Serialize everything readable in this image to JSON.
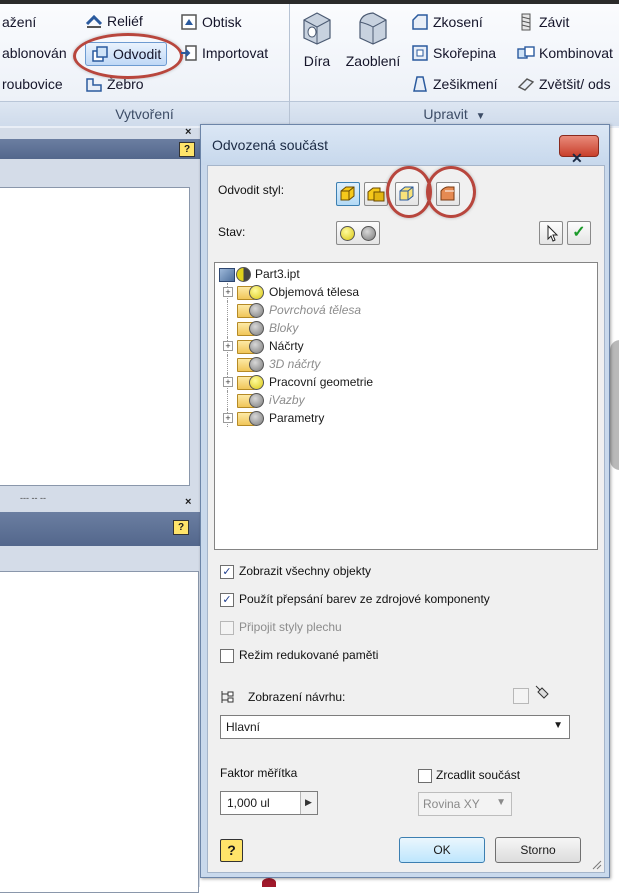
{
  "ribbon": {
    "col1": [
      "ažení",
      "ablonován",
      "roubovice"
    ],
    "col2": [
      "Reliéf",
      "Odvodit",
      "Žebro"
    ],
    "col3": [
      "Obtisk",
      "Importovat"
    ],
    "big_buttons": [
      "Díra",
      "Zaoblení"
    ],
    "col4": [
      "Zkosení",
      "Skořepina",
      "Zešikmení"
    ],
    "col5": [
      "Závit",
      "Kombinovat",
      "Zvětšit/ ods"
    ],
    "panel_create": "Vytvoření",
    "panel_modify": "Upravit",
    "panel_modify_arrow": "▼"
  },
  "left_pane": {
    "close_glyph": "×",
    "help_glyph": "?",
    "fragment": "--- -- --"
  },
  "dialog": {
    "title": "Odvozená součást",
    "close_glyph": "✕",
    "derive_style_label": "Odvodit styl:",
    "state_label": "Stav:",
    "tree": [
      {
        "label": "Part3.ipt",
        "level": 0,
        "icon": "part-icon",
        "expander": false,
        "state": "half",
        "disabled": false
      },
      {
        "label": "Objemová tělesa",
        "level": 1,
        "icon": "folder-icon",
        "expander": true,
        "state": "include",
        "disabled": false
      },
      {
        "label": "Povrchová tělesa",
        "level": 1,
        "icon": "folder-icon",
        "expander": false,
        "state": "exclude",
        "disabled": true
      },
      {
        "label": "Bloky",
        "level": 1,
        "icon": "folder-icon",
        "expander": false,
        "state": "exclude",
        "disabled": true
      },
      {
        "label": "Náčrty",
        "level": 1,
        "icon": "folder-icon",
        "expander": true,
        "state": "exclude",
        "disabled": false
      },
      {
        "label": "3D náčrty",
        "level": 1,
        "icon": "folder-icon",
        "expander": false,
        "state": "exclude",
        "disabled": true
      },
      {
        "label": "Pracovní geometrie",
        "level": 1,
        "icon": "folder-icon",
        "expander": true,
        "state": "include",
        "disabled": false
      },
      {
        "label": "iVazby",
        "level": 1,
        "icon": "folder-icon",
        "expander": false,
        "state": "exclude",
        "disabled": true
      },
      {
        "label": "Parametry",
        "level": 1,
        "icon": "folder-icon",
        "expander": true,
        "state": "exclude",
        "disabled": false
      }
    ],
    "options": [
      {
        "label": "Zobrazit všechny objekty",
        "checked": true,
        "disabled": false
      },
      {
        "label": "Použít přepsání barev ze zdrojové komponenty",
        "checked": true,
        "disabled": false
      },
      {
        "label": "Připojit styly plechu",
        "checked": false,
        "disabled": true
      },
      {
        "label": "Režim redukované paměti",
        "checked": false,
        "disabled": false
      }
    ],
    "design_view_label": "Zobrazení návrhu:",
    "design_view_value": "Hlavní",
    "scale_label": "Faktor měřítka",
    "scale_value": "1,000 ul",
    "mirror_label": "Zrcadlit součást",
    "plane_value": "Rovina XY",
    "ok_label": "OK",
    "cancel_label": "Storno",
    "help_glyph": "?",
    "check_glyph": "✓",
    "dropdown_glyph": "▼",
    "spin_glyph": "▶"
  },
  "colors": {
    "highlight": "#b8463d",
    "dialog_frame": "#c9d9ec",
    "include": "#e0d21c"
  }
}
